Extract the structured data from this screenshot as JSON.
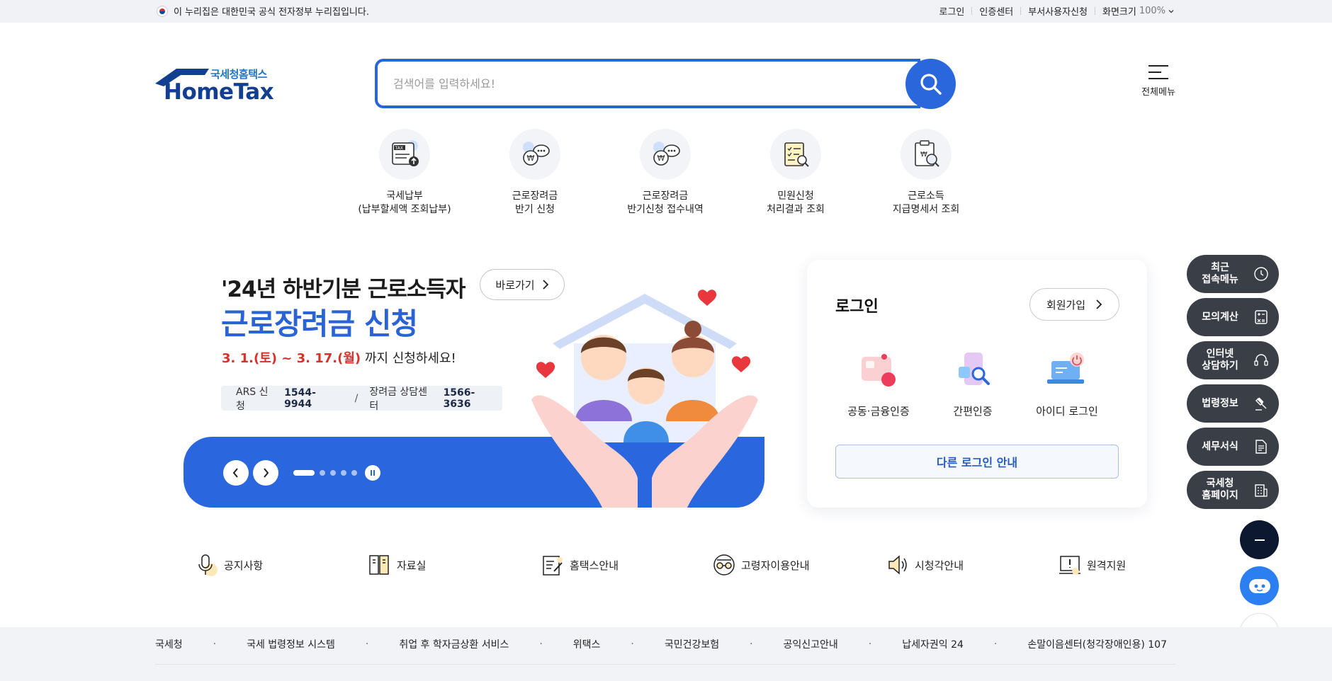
{
  "gov_bar": {
    "notice": "이 누리집은 대한민국 공식 전자정부 누리집입니다.",
    "links": [
      "로그인",
      "인증센터",
      "부서사용자신청",
      "화면크기"
    ],
    "zoom": "100%"
  },
  "logo": {
    "sub": "국세청홈택스",
    "main": "HomeTax"
  },
  "search": {
    "placeholder": "검색어를 입력하세요!"
  },
  "all_menu": {
    "label": "전체메뉴"
  },
  "quick_menu": [
    {
      "line1": "국세납부",
      "line2": "(납부할세액 조회납부)"
    },
    {
      "line1": "근로장려금",
      "line2": "반기 신청"
    },
    {
      "line1": "근로장려금",
      "line2": "반기신청 접수내역"
    },
    {
      "line1": "민원신청",
      "line2": "처리결과 조회"
    },
    {
      "line1": "근로소득",
      "line2": "지급명세서 조회"
    }
  ],
  "banner": {
    "title1": "'24년 하반기분 근로소득자",
    "title2": "근로장려금 신청",
    "goto": "바로가기",
    "period_red": "3. 1.(토) ~ 3. 17.(월)",
    "period_rest": " 까지 신청하세요!",
    "ars_label": "ARS 신청",
    "ars_num": "1544-9944",
    "center_label": "장려금 상담센터",
    "center_num": "1566-3636",
    "slide_total": 5,
    "slide_active": 1
  },
  "login": {
    "title": "로그인",
    "join": "회원가입",
    "methods": [
      "공동·금융인증",
      "간편인증",
      "아이디 로그인"
    ],
    "other": "다른 로그인 안내"
  },
  "side_menu": [
    {
      "line1": "최근",
      "line2": "접속메뉴",
      "icon": "clock-icon"
    },
    {
      "line1": "모의계산",
      "line2": "",
      "icon": "calculator-icon"
    },
    {
      "line1": "인터넷",
      "line2": "상담하기",
      "icon": "headset-icon"
    },
    {
      "line1": "법령정보",
      "line2": "",
      "icon": "gavel-icon"
    },
    {
      "line1": "세무서식",
      "line2": "",
      "icon": "document-icon"
    },
    {
      "line1": "국세청",
      "line2": "홈페이지",
      "icon": "building-icon"
    }
  ],
  "services": [
    "공지사항",
    "자료실",
    "홈택스안내",
    "고령자이용안내",
    "시청각안내",
    "원격지원"
  ],
  "footer_links": [
    "국세청",
    "국세 법령정보 시스템",
    "취업 후 학자금상환 서비스",
    "위택스",
    "국민건강보험",
    "공익신고안내",
    "납세자권익 24",
    "손말이음센터(청각장애인용) 107"
  ],
  "colors": {
    "primary": "#2a66dd",
    "dark_side": "#3a3e47",
    "accent_red": "#d8312a"
  }
}
